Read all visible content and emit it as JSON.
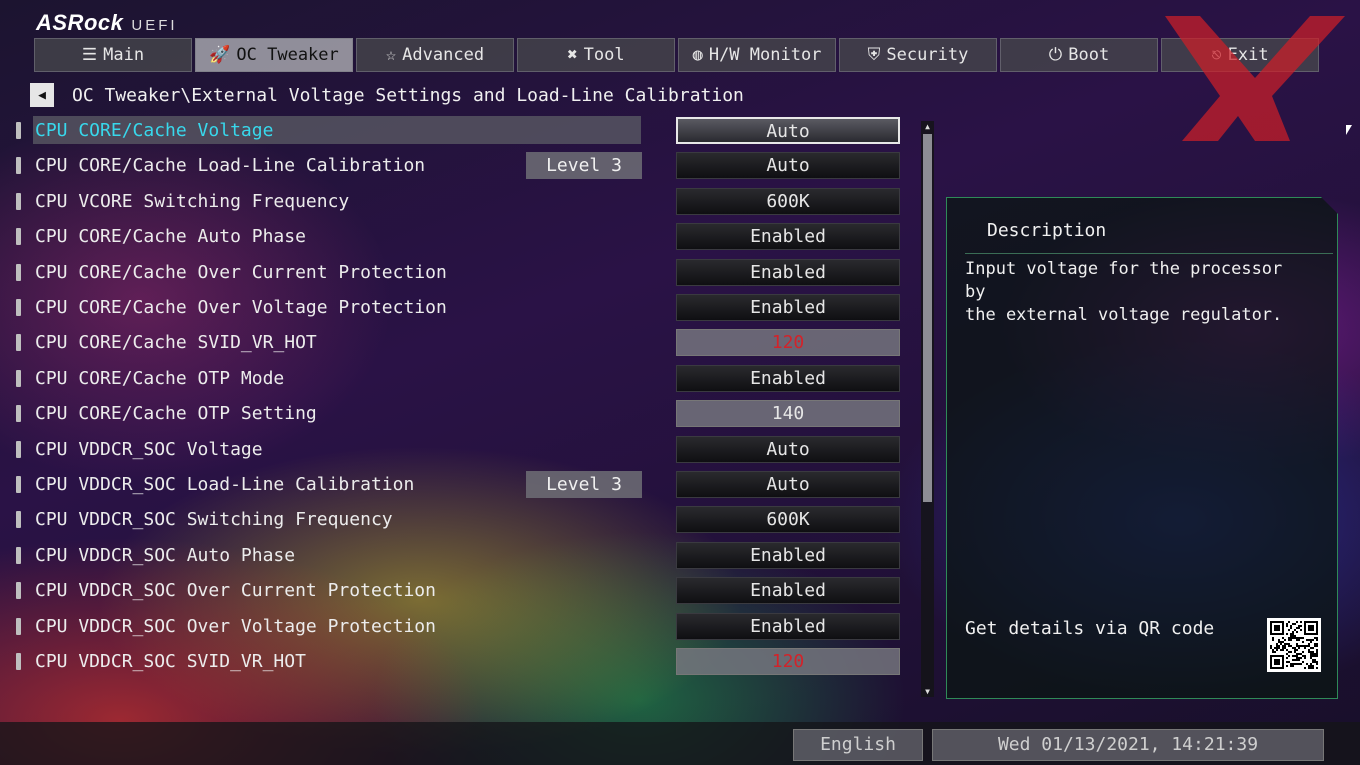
{
  "brand": {
    "logo": "ASRock",
    "uefi": "UEFI"
  },
  "nav": [
    {
      "label": "Main",
      "icon": "list-icon",
      "glyph": "☰"
    },
    {
      "label": "OC Tweaker",
      "icon": "rocket-icon",
      "glyph": "🚀"
    },
    {
      "label": "Advanced",
      "icon": "star-icon",
      "glyph": "☆"
    },
    {
      "label": "Tool",
      "icon": "tools-icon",
      "glyph": "✖"
    },
    {
      "label": "H/W Monitor",
      "icon": "monitor-icon",
      "glyph": "◍"
    },
    {
      "label": "Security",
      "icon": "shield-icon",
      "glyph": "⛨"
    },
    {
      "label": "Boot",
      "icon": "power-icon",
      "glyph": "⏻"
    },
    {
      "label": "Exit",
      "icon": "exit-icon",
      "glyph": "⎋"
    }
  ],
  "active_tab": 1,
  "breadcrumb": "OC Tweaker\\External Voltage Settings and Load-Line Calibration",
  "settings": [
    {
      "label": "CPU CORE/Cache Voltage",
      "current": "",
      "value": "Auto",
      "kind": "select",
      "selected": true
    },
    {
      "label": "CPU CORE/Cache Load-Line Calibration",
      "current": "Level 3",
      "value": "Auto",
      "kind": "select"
    },
    {
      "label": "CPU VCORE Switching Frequency",
      "current": "",
      "value": "600K",
      "kind": "select"
    },
    {
      "label": "CPU CORE/Cache Auto Phase",
      "current": "",
      "value": "Enabled",
      "kind": "select"
    },
    {
      "label": "CPU CORE/Cache Over Current Protection",
      "current": "",
      "value": "Enabled",
      "kind": "select"
    },
    {
      "label": "CPU CORE/Cache Over Voltage Protection",
      "current": "",
      "value": "Enabled",
      "kind": "select"
    },
    {
      "label": "CPU CORE/Cache SVID_VR_HOT",
      "current": "",
      "value": "120",
      "kind": "number",
      "red": true
    },
    {
      "label": "CPU CORE/Cache OTP Mode",
      "current": "",
      "value": "Enabled",
      "kind": "select"
    },
    {
      "label": "CPU CORE/Cache OTP Setting",
      "current": "",
      "value": "140",
      "kind": "number"
    },
    {
      "label": "CPU VDDCR_SOC Voltage",
      "current": "",
      "value": "Auto",
      "kind": "select"
    },
    {
      "label": "CPU VDDCR_SOC Load-Line Calibration",
      "current": "Level 3",
      "value": "Auto",
      "kind": "select"
    },
    {
      "label": "CPU VDDCR_SOC Switching Frequency",
      "current": "",
      "value": "600K",
      "kind": "select"
    },
    {
      "label": "CPU VDDCR_SOC Auto Phase",
      "current": "",
      "value": "Enabled",
      "kind": "select"
    },
    {
      "label": "CPU VDDCR_SOC Over Current Protection",
      "current": "",
      "value": "Enabled",
      "kind": "select"
    },
    {
      "label": "CPU VDDCR_SOC Over Voltage Protection",
      "current": "",
      "value": "Enabled",
      "kind": "select"
    },
    {
      "label": "CPU VDDCR_SOC SVID_VR_HOT",
      "current": "",
      "value": "120",
      "kind": "number",
      "red": true
    }
  ],
  "description": {
    "title": "Description",
    "text": "Input voltage for the processor by\nthe external voltage regulator.",
    "qr_label": "Get details via QR code"
  },
  "status": {
    "language": "English",
    "datetime": "Wed 01/13/2021, 14:21:39"
  },
  "colors": {
    "selected_text": "#38d8ec",
    "warning_value": "#d2232a",
    "panel_border": "#2f8a58"
  }
}
